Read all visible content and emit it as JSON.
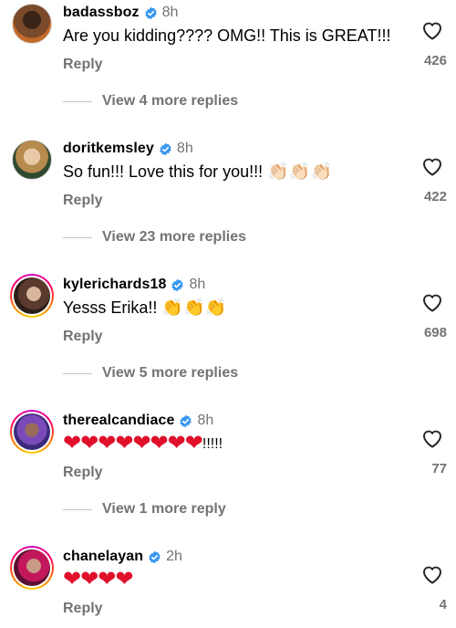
{
  "colors": {
    "verified": "#3897f0",
    "secondary_text": "#737373",
    "heart": "#e0102d"
  },
  "icons": {
    "verified": "verified-badge-icon",
    "like": "heart-outline-icon"
  },
  "comments": [
    {
      "username": "badassboz",
      "time": "8h",
      "text": "Are you kidding???? OMG!! This is GREAT!!!",
      "reply_label": "Reply",
      "likes": "426",
      "view_replies": "View 4 more replies"
    },
    {
      "username": "doritkemsley",
      "time": "8h",
      "text": "So fun!!! Love this for you!!!",
      "emoji": "👏🏻👏🏻👏🏻",
      "reply_label": "Reply",
      "likes": "422",
      "view_replies": "View 23 more replies"
    },
    {
      "username": "kylerichards18",
      "time": "8h",
      "text": "Yesss Erika!!",
      "emoji": "👏👏👏",
      "reply_label": "Reply",
      "likes": "698",
      "view_replies": "View 5 more replies"
    },
    {
      "username": "therealcandiace",
      "time": "8h",
      "hearts": "❤❤❤❤❤❤❤❤",
      "text": "!!!!!",
      "reply_label": "Reply",
      "likes": "77",
      "view_replies": "View 1 more reply"
    },
    {
      "username": "chanelayan",
      "time": "2h",
      "hearts": "❤❤❤❤",
      "reply_label": "Reply",
      "likes": "4"
    }
  ]
}
